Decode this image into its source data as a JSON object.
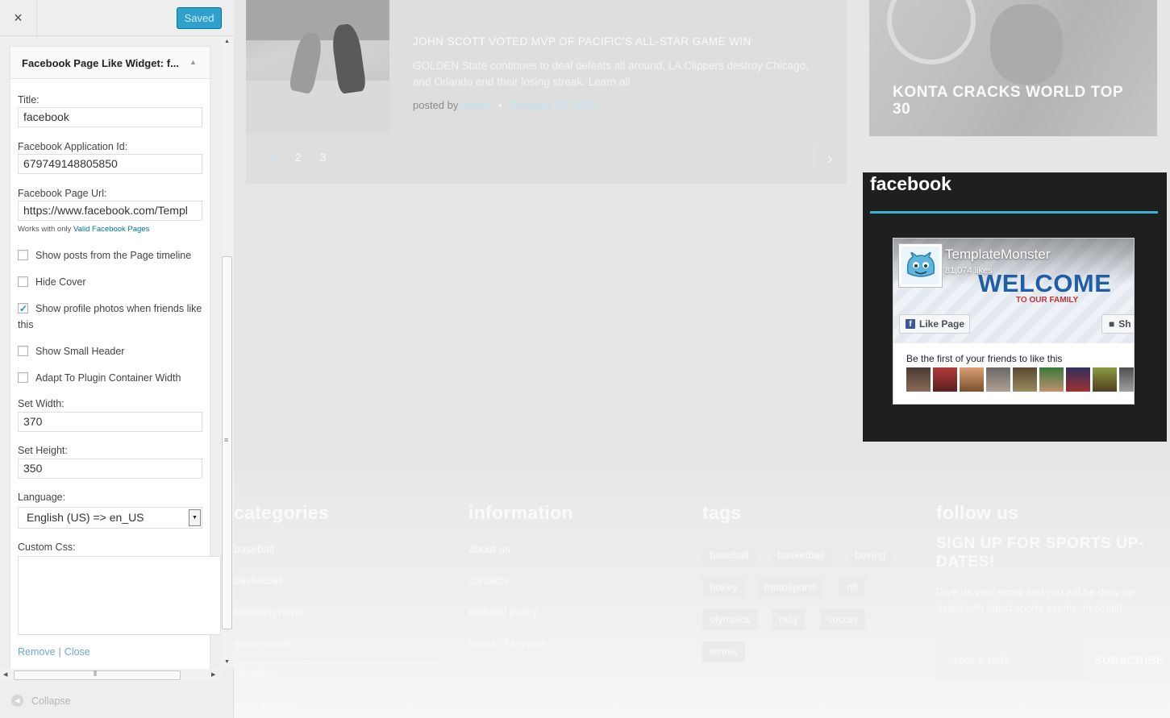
{
  "sidebar": {
    "close_icon": "×",
    "saved_label": "Saved",
    "widget_title": "Facebook Page Like Widget: f...",
    "toggle_icon": "▲",
    "fields": {
      "title_label": "Title:",
      "title_value": "facebook",
      "app_id_label": "Facebook Application Id:",
      "app_id_value": "679749148805850",
      "page_url_label": "Facebook Page Url:",
      "page_url_value": "https://www.facebook.com/Templ",
      "help_prefix": "Works with only ",
      "help_link": "Valid Facebook Pages",
      "width_label": "Set Width:",
      "width_value": "370",
      "height_label": "Set Height:",
      "height_value": "350",
      "language_label": "Language:",
      "language_value": "English (US) => en_US",
      "custom_css_label": "Custom Css:"
    },
    "checkboxes": [
      {
        "label": "Show posts from the Page timeline",
        "checked": false
      },
      {
        "label": "Hide Cover",
        "checked": false
      },
      {
        "label": "Show profile photos when friends like this",
        "checked": true
      },
      {
        "label": "Show Small Header",
        "checked": false
      },
      {
        "label": "Adapt To Plugin Container Width",
        "checked": false
      }
    ],
    "remove_label": "Remove",
    "separator": "|",
    "close_label": "Close",
    "collapse_label": "Collapse"
  },
  "preview": {
    "post": {
      "title": "JOHN SCOTT VOTED MVP OF PACIFIC'S ALL-STAR GAME WIN",
      "excerpt": "GOLDEN State continues to deal defeats all around, LA Clippers destroy Chicago, and Orlando end their losing streak. Learn all",
      "posted_by": "posted by ",
      "author": "Admin",
      "bullet": "•",
      "date": "February 24, 2016"
    },
    "pagination": [
      "1",
      "2",
      "3"
    ],
    "pagination_active": "1",
    "feature_title": "KONTA CRACKS WORLD TOP 30",
    "facebook": {
      "widget_title": "facebook",
      "page_name": "TemplateMonster",
      "likes": "81,074 likes",
      "welcome": "WELCOME",
      "tagline": "TO OUR FAMILY",
      "like_button": "Like Page",
      "share_button": "Sh",
      "friends_text": "Be the first of your friends to like this"
    },
    "footer": {
      "categories_title": "categories",
      "categories": [
        "baseball",
        "basketball",
        "breaking news",
        "motorsports",
        "olympics",
        "other sports"
      ],
      "information_title": "information",
      "information": [
        "about us",
        "contacts",
        "editorial policy",
        "terms of service"
      ],
      "tags_title": "tags",
      "tags": [
        "baseball",
        "basketball",
        "boxing",
        "hokey",
        "motosports",
        "nfl",
        "olympics",
        "rally",
        "soccer",
        "tennis"
      ],
      "follow_title": "follow us",
      "signup_title": "SIGN UP FOR SPORTS UP-DATES!",
      "signup_text": "Give us your email and you will be daily up-dated with latest sports events, in detail!",
      "email_placeholder": "Your e-mail",
      "subscribe_label": "SUBSCRIBE"
    }
  },
  "colors": {
    "accent": "#2ea2cc",
    "facebook_underline": "#3bb3d6",
    "facebook_blue": "#3b5998"
  }
}
